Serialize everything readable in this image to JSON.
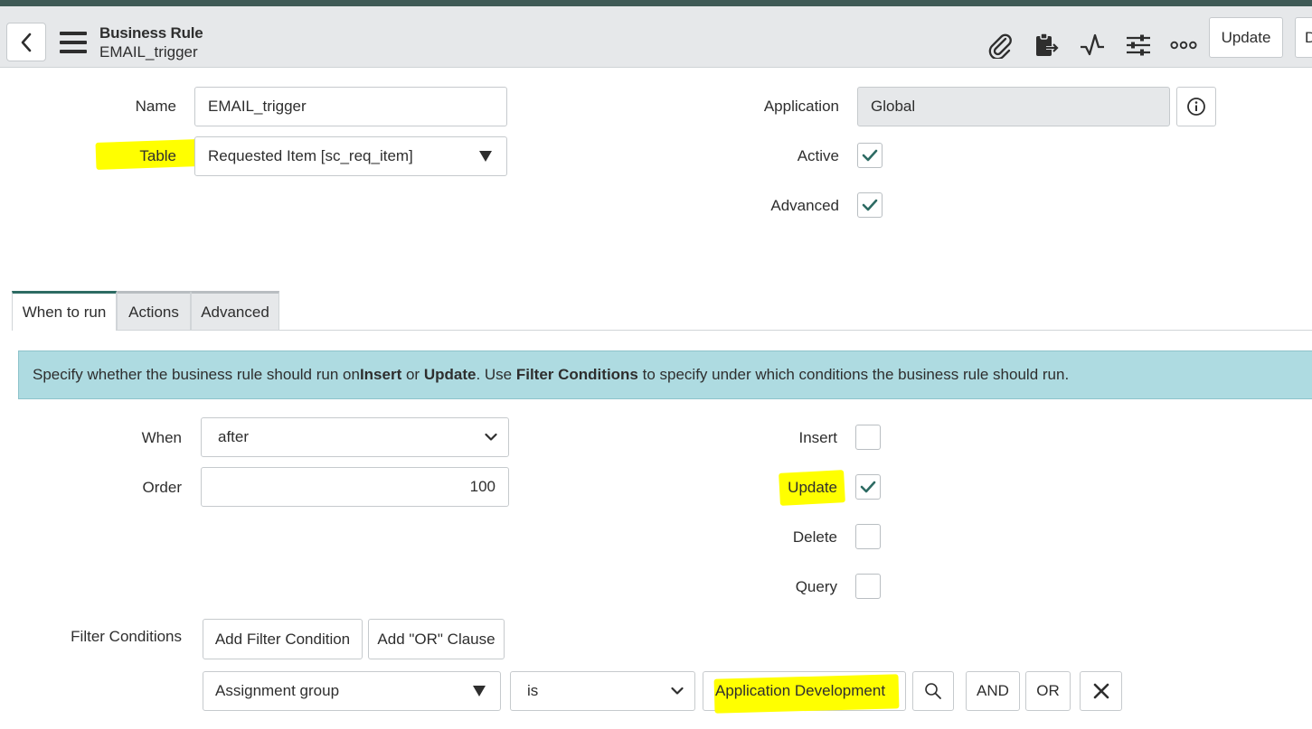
{
  "header": {
    "title": "Business Rule",
    "subtitle": "EMAIL_trigger",
    "update_label": "Update",
    "next_button_partial": "D"
  },
  "form": {
    "name_label": "Name",
    "name_value": "EMAIL_trigger",
    "table_label": "Table",
    "table_value": "Requested Item [sc_req_item]",
    "application_label": "Application",
    "application_value": "Global",
    "active_label": "Active",
    "active_checked": true,
    "advanced_label": "Advanced",
    "advanced_checked": true
  },
  "tabs": [
    {
      "label": "When to run",
      "active": true
    },
    {
      "label": "Actions",
      "active": false
    },
    {
      "label": "Advanced",
      "active": false
    }
  ],
  "info_banner": {
    "t1": "Specify whether the business rule should run on ",
    "b1": "Insert",
    "t2": " or ",
    "b2": "Update",
    "t3": ". Use ",
    "b3": "Filter Conditions",
    "t4": " to specify under which conditions the business rule should run."
  },
  "when_to_run": {
    "when_label": "When",
    "when_value": "after",
    "order_label": "Order",
    "order_value": "100",
    "insert_label": "Insert",
    "insert_checked": false,
    "update_label": "Update",
    "update_checked": true,
    "delete_label": "Delete",
    "delete_checked": false,
    "query_label": "Query",
    "query_checked": false,
    "filter_label": "Filter Conditions",
    "add_filter_label": "Add Filter Condition",
    "add_or_label": "Add \"OR\" Clause",
    "condition": {
      "field": "Assignment group",
      "operator": "is",
      "value": "Application Development",
      "and_label": "AND",
      "or_label": "OR"
    }
  },
  "colors": {
    "accent": "#2d6b63",
    "highlight": "#ffff00",
    "info_bg": "#aedbe1",
    "header_bg": "#e6e8ea"
  },
  "icons": [
    "back-chevron-icon",
    "hamburger-menu-icon",
    "paperclip-icon",
    "clipboard-arrow-icon",
    "activity-pulse-icon",
    "sliders-icon",
    "more-options-icon",
    "info-icon",
    "checkmark-icon",
    "chevron-down-icon",
    "dropdown-triangle-icon",
    "search-magnifier-icon",
    "close-x-icon"
  ]
}
